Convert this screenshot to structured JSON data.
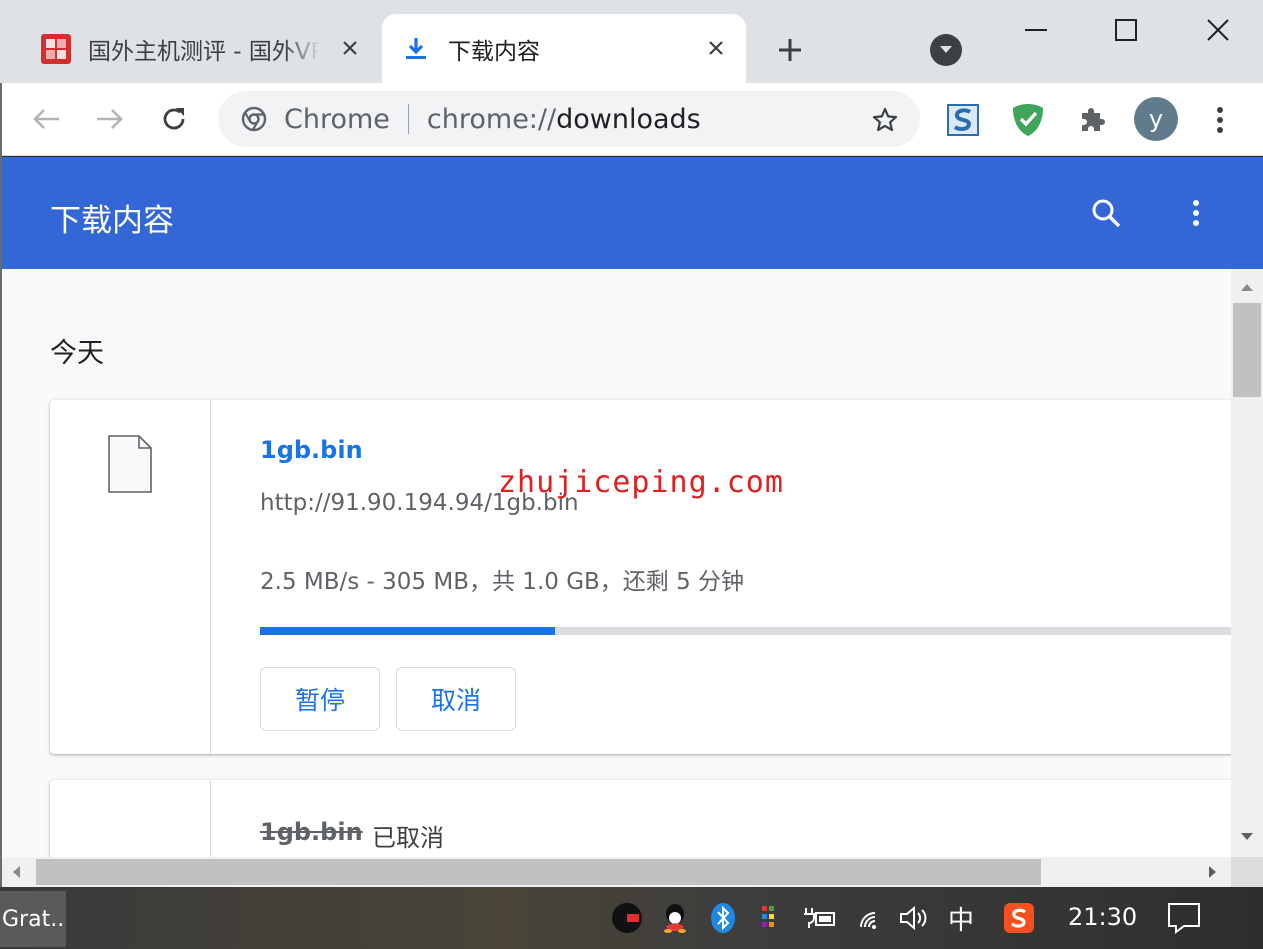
{
  "tabs": [
    {
      "title": "国外主机测评 - 国外VPS",
      "active": false
    },
    {
      "title": "下载内容",
      "active": true
    }
  ],
  "omnibox": {
    "chip": "Chrome",
    "scheme": "chrome://",
    "path": "downloads"
  },
  "profile": {
    "initial": "y"
  },
  "page": {
    "title": "下载内容",
    "date_group": "今天"
  },
  "downloads": [
    {
      "file_name": "1gb.bin",
      "url": "http://91.90.194.94/1gb.bin",
      "status": "2.5 MB/s - 305 MB，共 1.0 GB，还剩 5 分钟",
      "progress": 0.298,
      "buttons": {
        "pause": "暂停",
        "cancel": "取消"
      }
    },
    {
      "file_name": "1gb.bin",
      "status": "已取消"
    }
  ],
  "watermark": "zhujiceping.com",
  "taskbar": {
    "app_label": "Grat...",
    "ime": "中",
    "clock": "21:30"
  },
  "colors": {
    "header_blue": "#3367d6",
    "link_blue": "#1a73e8",
    "watermark_red": "#e02020"
  }
}
